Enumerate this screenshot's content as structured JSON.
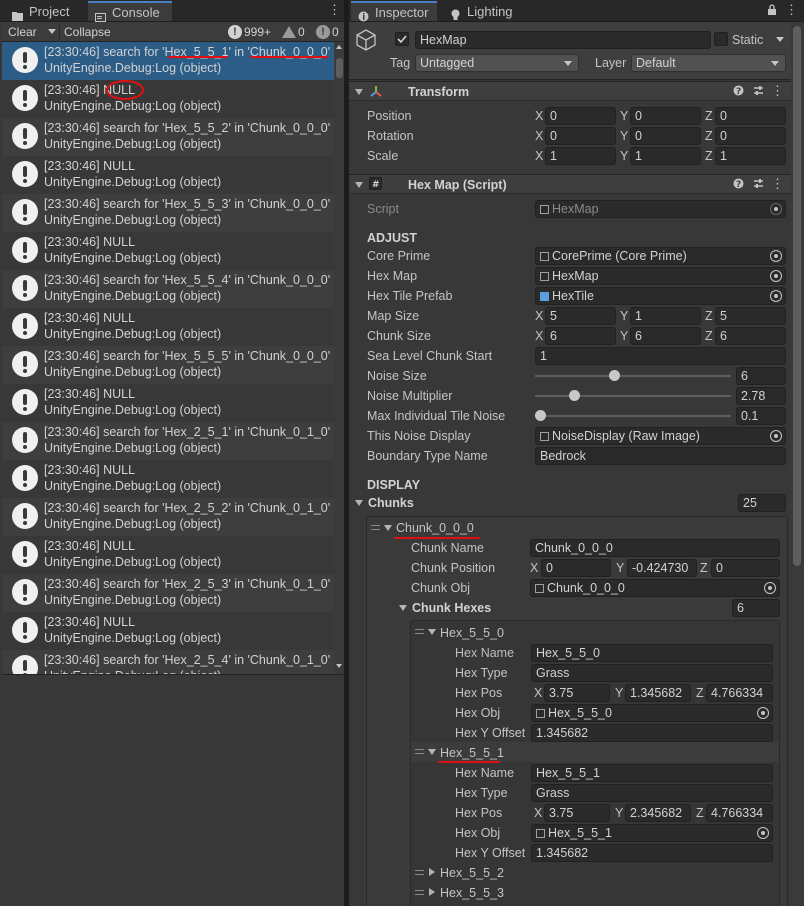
{
  "tabs_left": {
    "project": "Project",
    "console": "Console"
  },
  "tabs_right": {
    "inspector": "Inspector",
    "lighting": "Lighting"
  },
  "console": {
    "clear": "Clear",
    "collapse": "Collapse",
    "count_log": "999+",
    "count_warn": "0",
    "count_error": "0",
    "source_line": "UnityEngine.Debug:Log (object)",
    "entries": [
      "[23:30:46] search for 'Hex_5_5_1' in 'Chunk_0_0_0'",
      "[23:30:46] NULL",
      "[23:30:46] search for 'Hex_5_5_2' in 'Chunk_0_0_0'",
      "[23:30:46] NULL",
      "[23:30:46] search for 'Hex_5_5_3' in 'Chunk_0_0_0'",
      "[23:30:46] NULL",
      "[23:30:46] search for 'Hex_5_5_4' in 'Chunk_0_0_0'",
      "[23:30:46] NULL",
      "[23:30:46] search for 'Hex_5_5_5' in 'Chunk_0_0_0'",
      "[23:30:46] NULL",
      "[23:30:46] search for 'Hex_2_5_1' in 'Chunk_0_1_0'",
      "[23:30:46] NULL",
      "[23:30:46] search for 'Hex_2_5_2' in 'Chunk_0_1_0'",
      "[23:30:46] NULL",
      "[23:30:46] search for 'Hex_2_5_3' in 'Chunk_0_1_0'",
      "[23:30:46] NULL",
      "[23:30:46] search for 'Hex_2_5_4' in 'Chunk_0_1_0'"
    ]
  },
  "inspector": {
    "object_name": "HexMap",
    "static_label": "Static",
    "tag_label": "Tag",
    "tag_value": "Untagged",
    "layer_label": "Layer",
    "layer_value": "Default",
    "transform": {
      "title": "Transform",
      "position_label": "Position",
      "position": [
        "0",
        "0",
        "0"
      ],
      "rotation_label": "Rotation",
      "rotation": [
        "0",
        "0",
        "0"
      ],
      "scale_label": "Scale",
      "scale": [
        "1",
        "1",
        "1"
      ]
    },
    "script_comp": {
      "title": "Hex Map (Script)",
      "script_label": "Script",
      "script_value": "HexMap"
    },
    "adjust": {
      "header": "ADJUST",
      "core_prime_label": "Core Prime",
      "core_prime": "CorePrime (Core Prime)",
      "hex_map_label": "Hex Map",
      "hex_map": "HexMap",
      "hex_tile_prefab_label": "Hex Tile Prefab",
      "hex_tile_prefab": "HexTile",
      "map_size_label": "Map Size",
      "map_size": [
        "5",
        "1",
        "5"
      ],
      "chunk_size_label": "Chunk Size",
      "chunk_size": [
        "6",
        "6",
        "6"
      ],
      "sea_level_label": "Sea Level Chunk Start",
      "sea_level": "1",
      "noise_size_label": "Noise Size",
      "noise_size": "6",
      "noise_mult_label": "Noise Multiplier",
      "noise_mult": "2.78",
      "max_noise_label": "Max Individual Tile Noise",
      "max_noise": "0.1",
      "noise_display_label": "This Noise Display",
      "noise_display": "NoiseDisplay (Raw Image)",
      "boundary_label": "Boundary Type Name",
      "boundary": "Bedrock"
    },
    "sliders": {
      "noise_size": 0.39,
      "noise_mult": 0.19,
      "max_noise": 0.02
    },
    "display": {
      "header": "DISPLAY",
      "chunks_label": "Chunks",
      "chunks_count": "25",
      "chunk0": {
        "title": "Chunk_0_0_0",
        "name_label": "Chunk Name",
        "name": "Chunk_0_0_0",
        "pos_label": "Chunk Position",
        "pos": [
          "0",
          "-0.424730",
          "0"
        ],
        "obj_label": "Chunk Obj",
        "obj": "Chunk_0_0_0",
        "hexes_label": "Chunk Hexes",
        "hexes_count": "6",
        "hex0": {
          "title": "Hex_5_5_0",
          "name_label": "Hex Name",
          "name": "Hex_5_5_0",
          "type_label": "Hex Type",
          "type": "Grass",
          "pos_label": "Hex Pos",
          "pos": [
            "3.75",
            "1.345682",
            "4.766334"
          ],
          "obj_label": "Hex Obj",
          "obj": "Hex_5_5_0",
          "yoff_label": "Hex Y Offset",
          "yoff": "1.345682"
        },
        "hex1": {
          "title": "Hex_5_5_1",
          "name_label": "Hex Name",
          "name": "Hex_5_5_1",
          "type_label": "Hex Type",
          "type": "Grass",
          "pos_label": "Hex Pos",
          "pos": [
            "3.75",
            "2.345682",
            "4.766334"
          ],
          "obj_label": "Hex Obj",
          "obj": "Hex_5_5_1",
          "yoff_label": "Hex Y Offset",
          "yoff": "1.345682"
        },
        "hex2_title": "Hex_5_5_2",
        "hex3_title": "Hex_5_5_3"
      }
    }
  },
  "axis": {
    "x": "X",
    "y": "Y",
    "z": "Z"
  },
  "colors": {
    "selection": "#2c5d87",
    "accent": "#4a7fc4",
    "annotation": "#e01010"
  }
}
